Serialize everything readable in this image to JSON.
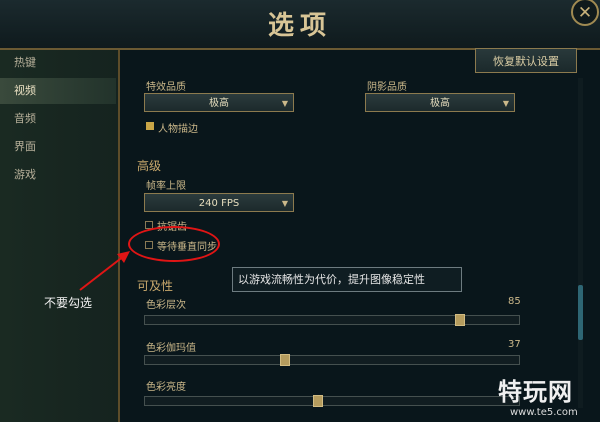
{
  "window": {
    "title": "选项",
    "close_glyph": "✕"
  },
  "sidebar": {
    "items": [
      {
        "label": "热键"
      },
      {
        "label": "视频"
      },
      {
        "label": "音频"
      },
      {
        "label": "界面"
      },
      {
        "label": "游戏"
      }
    ]
  },
  "toolbar": {
    "reset_label": "恢复默认设置"
  },
  "quality": {
    "effects_label": "特效品质",
    "effects_value": "极高",
    "shadow_label": "阴影品质",
    "shadow_value": "极高",
    "outline_label": "人物描边",
    "outline_checked": true
  },
  "advanced": {
    "section_title": "高级",
    "fps_label": "帧率上限",
    "fps_value": "240 FPS",
    "antialias_label": "抗锯齿",
    "antialias_checked": false,
    "vsync_label": "等待垂直同步",
    "vsync_checked": false
  },
  "tooltip": {
    "text": "以游戏流畅性为代价，提升图像稳定性"
  },
  "accessibility": {
    "section_title": "可及性",
    "sliders": [
      {
        "label": "色彩层次",
        "value": "85"
      },
      {
        "label": "色彩伽玛值",
        "value": "37"
      },
      {
        "label": "色彩亮度",
        "value": ""
      }
    ]
  },
  "annotation": {
    "text": "不要勾选",
    "color": "#e01515"
  },
  "watermark": {
    "main": "特玩网",
    "sub": "www.te5.com"
  },
  "colors": {
    "accent_gold": "#c9a647",
    "background": "#0b1519",
    "border": "#8c7a4e"
  }
}
